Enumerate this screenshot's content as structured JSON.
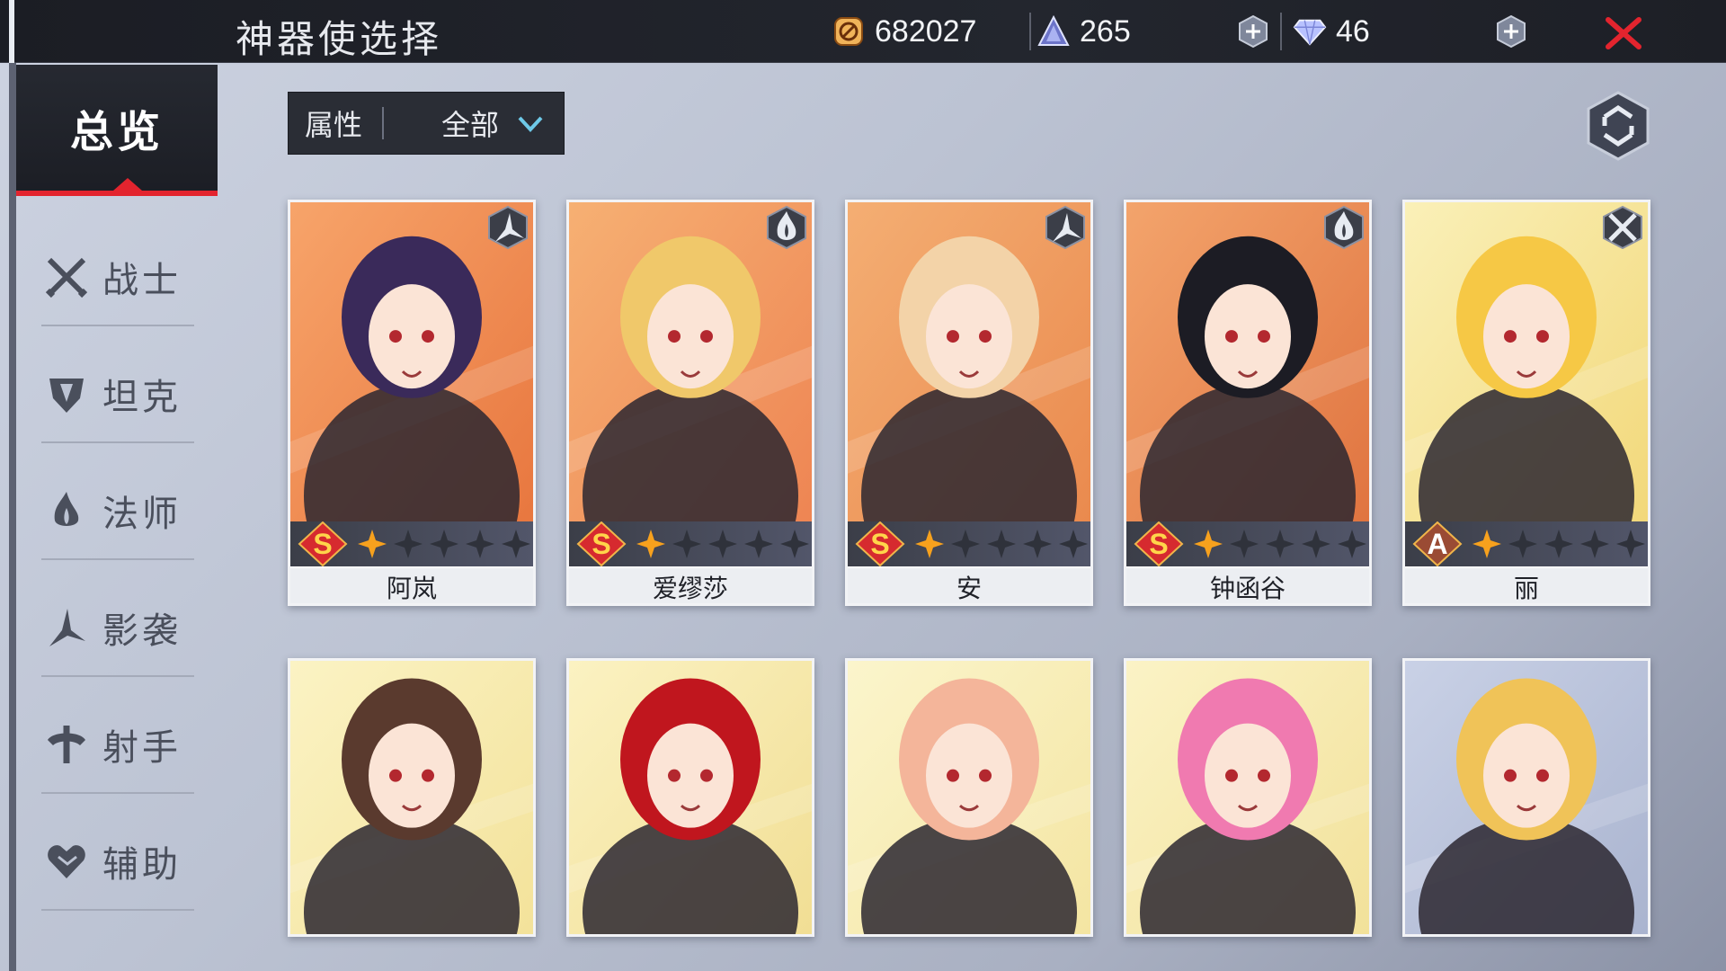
{
  "header": {
    "title": "神器使选择",
    "resources": [
      {
        "name": "coin-icon",
        "value": "682027"
      },
      {
        "name": "crystal-icon",
        "value": "265"
      },
      {
        "name": "diamond-icon",
        "value": "46"
      }
    ]
  },
  "sidebar": {
    "overview_label": "总览",
    "items": [
      {
        "label": "战士",
        "icon": "warrior-icon"
      },
      {
        "label": "坦克",
        "icon": "tank-icon"
      },
      {
        "label": "法师",
        "icon": "mage-icon"
      },
      {
        "label": "影袭",
        "icon": "assassin-icon"
      },
      {
        "label": "射手",
        "icon": "marksman-icon"
      },
      {
        "label": "辅助",
        "icon": "support-icon"
      }
    ]
  },
  "filter": {
    "label": "属性",
    "value": "全部"
  },
  "cards": [
    {
      "name": "阿岚",
      "rank": "S",
      "stars": 1,
      "class_icon": "assassin-icon",
      "palette": [
        "#f7a46a",
        "#e8773f"
      ]
    },
    {
      "name": "爱缪莎",
      "rank": "S",
      "stars": 1,
      "class_icon": "mage-icon",
      "palette": [
        "#f6b073",
        "#ee8553"
      ]
    },
    {
      "name": "安",
      "rank": "S",
      "stars": 1,
      "class_icon": "assassin-icon",
      "palette": [
        "#f4ae73",
        "#ea8a4e"
      ]
    },
    {
      "name": "钟函谷",
      "rank": "S",
      "stars": 1,
      "class_icon": "mage-icon",
      "palette": [
        "#f3a46c",
        "#e07440"
      ]
    },
    {
      "name": "丽",
      "rank": "A",
      "stars": 1,
      "class_icon": "warrior-icon",
      "palette": [
        "#faf0b8",
        "#f2d87a"
      ]
    }
  ],
  "cards_row2": [
    {
      "class_icon": "marksman-icon",
      "palette": [
        "#fbf3c4",
        "#f3e29a"
      ]
    },
    {
      "class_icon": "mage-icon",
      "palette": [
        "#fbf2c2",
        "#f1de94"
      ]
    },
    {
      "class_icon": "tank-icon",
      "palette": [
        "#fbf5cc",
        "#f4e5a2"
      ]
    },
    {
      "class_icon": "support-icon",
      "palette": [
        "#fbf3c6",
        "#f2e19a"
      ]
    },
    {
      "class_icon": "marksman-icon",
      "palette": [
        "#c9d1e6",
        "#aab4cf"
      ]
    }
  ]
}
